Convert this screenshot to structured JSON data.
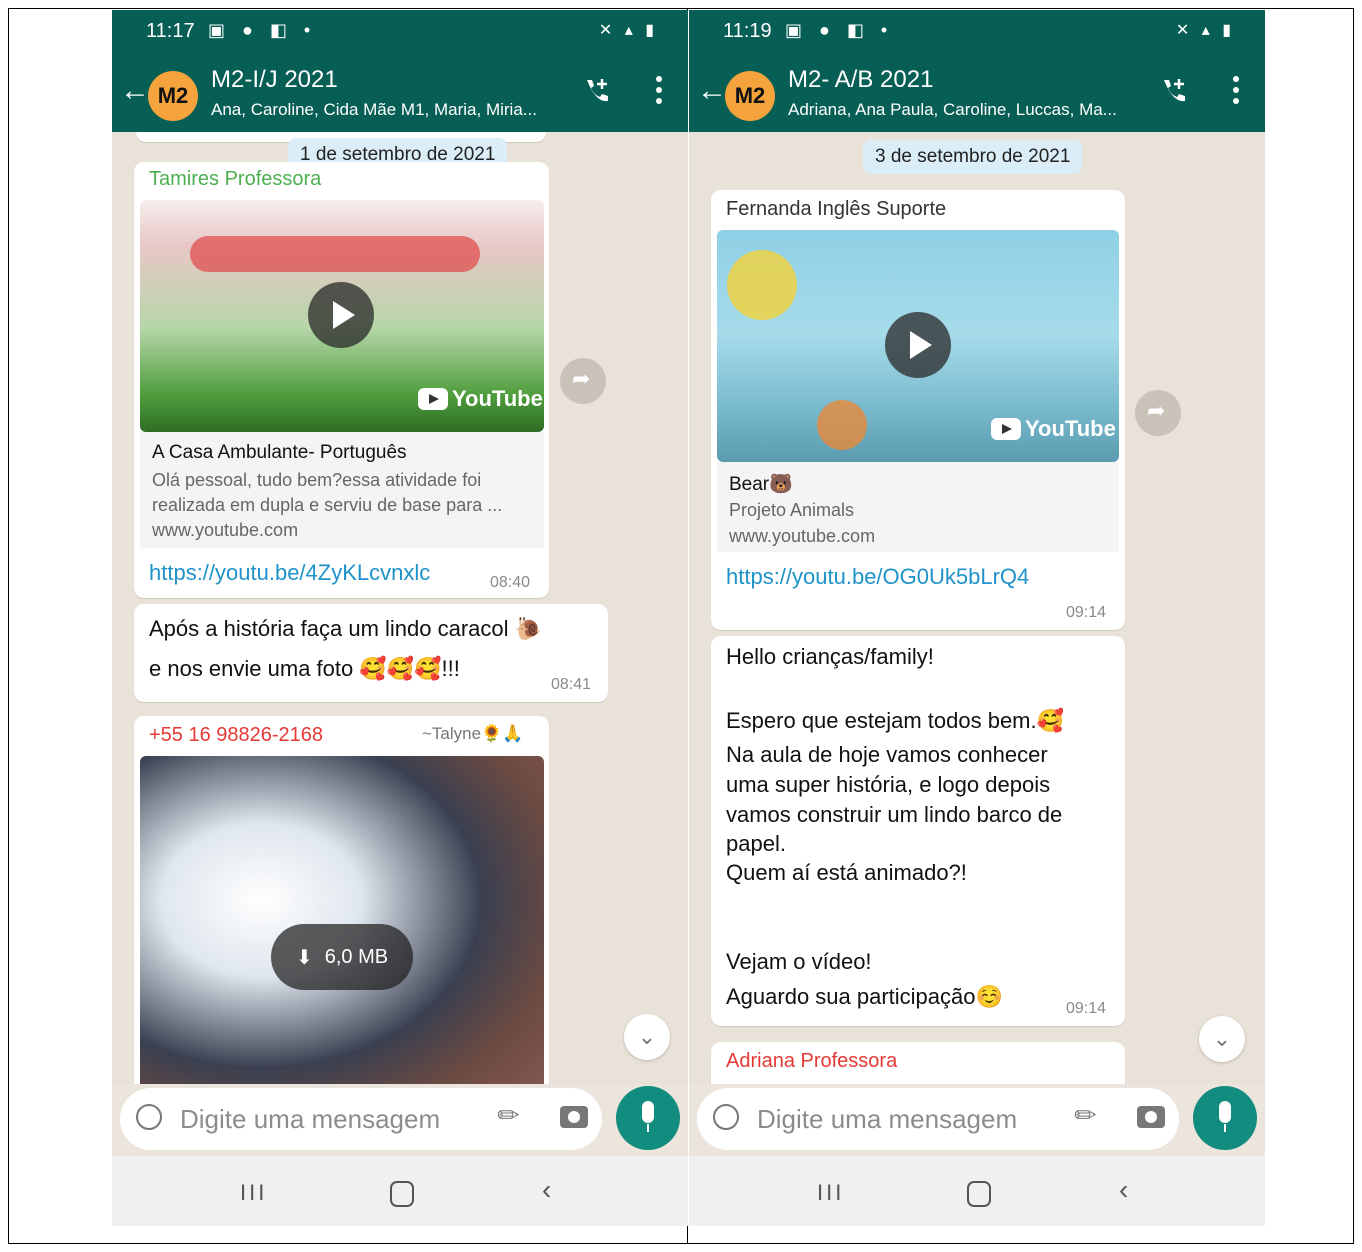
{
  "left": {
    "status_time": "11:17",
    "chat_title": "M2-I/J 2021",
    "avatar_label": "M2",
    "participants": "Ana, Caroline, Cida Mãe M1, Maria, Miria...",
    "date": "1 de setembro de 2021",
    "msg1": {
      "sender": "Tamires Professora",
      "preview_title": "A Casa Ambulante- Português",
      "preview_desc": "Olá pessoal, tudo bem?essa atividade foi realizada em dupla e serviu de base para ...",
      "preview_domain": "www.youtube.com",
      "youtube_label": "YouTube",
      "link": "https://youtu.be/4ZyKLcvnxlc",
      "time": "08:40"
    },
    "msg2": {
      "line1": "Após a história faça um lindo caracol 🐌",
      "line2": "e nos envie uma foto 🥰🥰🥰!!!",
      "time": "08:41"
    },
    "msg3": {
      "sender": "+55 16 98826-2168",
      "sender_alias": "~Talyne🌻🙏",
      "download_size": "6,0 MB"
    },
    "input_placeholder": "Digite uma mensagem"
  },
  "right": {
    "status_time": "11:19",
    "chat_title": "M2- A/B 2021",
    "avatar_label": "M2",
    "participants": "Adriana, Ana Paula, Caroline, Luccas, Ma...",
    "date": "3 de setembro de 2021",
    "msg1": {
      "sender": "Fernanda Inglês Suporte",
      "preview_title": "Bear🐻",
      "preview_desc": "Projeto Animals",
      "preview_domain": "www.youtube.com",
      "youtube_label": "YouTube",
      "link": "https://youtu.be/OG0Uk5bLrQ4",
      "time": "09:14"
    },
    "msg2": {
      "line1": "Hello crianças/family!",
      "line2": "Espero que estejam todos bem.🥰",
      "line3": "Na aula de hoje vamos conhecer",
      "line4": "uma super história, e logo depois",
      "line5": "vamos construir um lindo barco de",
      "line6": "papel.",
      "line7": "Quem aí está animado?!",
      "line8": "Vejam o vídeo!",
      "line9": "Aguardo sua participação☺️",
      "time": "09:14"
    },
    "msg3": {
      "sender": "Adriana Professora"
    },
    "input_placeholder": "Digite uma mensagem"
  },
  "colors": {
    "header": "#075e54",
    "accent": "#128c7e",
    "link": "#1f93c9",
    "avatar": "#f5a33c",
    "sender_green": "#4caf50",
    "sender_red": "#e53935"
  }
}
